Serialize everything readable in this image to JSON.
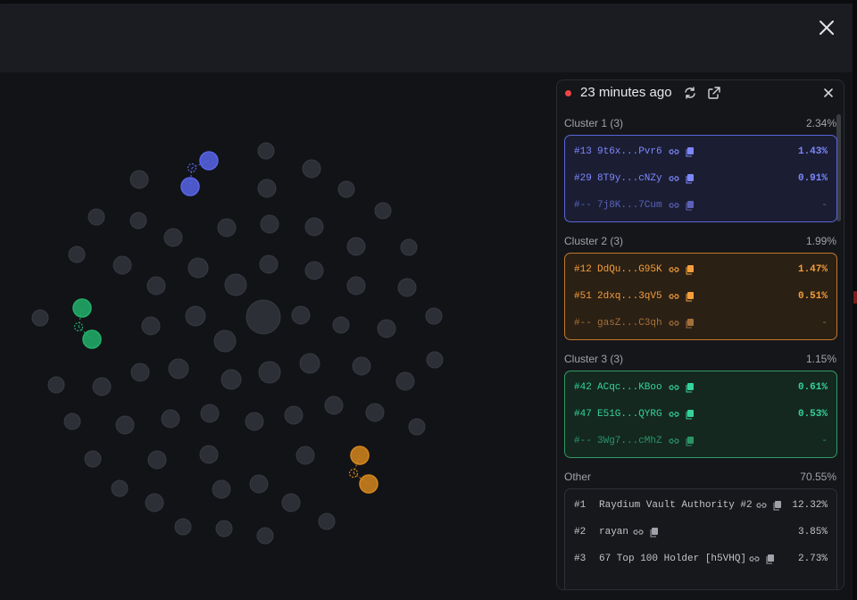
{
  "colors": {
    "blue": "#5865e8",
    "orange": "#d4861d",
    "green": "#22b06b",
    "node_gray": "#2d2f36",
    "live": "#ef4444"
  },
  "header": {
    "close_icon": "close-icon"
  },
  "panel": {
    "time": "23 minutes ago",
    "refresh_icon": "refresh-icon",
    "external_icon": "external-link-icon",
    "close_icon": "close-icon",
    "clusters": [
      {
        "title": "Cluster 1 (3)",
        "pct": "2.34%",
        "color": "blue",
        "rows": [
          {
            "rank": "#13",
            "address": "9t6x...Pvr6",
            "pct": "1.43%"
          },
          {
            "rank": "#29",
            "address": "8T9y...cNZy",
            "pct": "0.91%"
          },
          {
            "rank": "#--",
            "address": "7j8K...7Cum",
            "pct": "-"
          }
        ]
      },
      {
        "title": "Cluster 2 (3)",
        "pct": "1.99%",
        "color": "orange",
        "rows": [
          {
            "rank": "#12",
            "address": "DdQu...G95K",
            "pct": "1.47%"
          },
          {
            "rank": "#51",
            "address": "2dxq...3qV5",
            "pct": "0.51%"
          },
          {
            "rank": "#--",
            "address": "gasZ...C3qh",
            "pct": "-"
          }
        ]
      },
      {
        "title": "Cluster 3 (3)",
        "pct": "1.15%",
        "color": "green",
        "rows": [
          {
            "rank": "#42",
            "address": "ACqc...KBoo",
            "pct": "0.61%"
          },
          {
            "rank": "#47",
            "address": "E51G...QYRG",
            "pct": "0.53%"
          },
          {
            "rank": "#--",
            "address": "3Wg7...cMhZ",
            "pct": "-"
          }
        ]
      }
    ],
    "other": {
      "title": "Other",
      "pct": "70.55%",
      "rows": [
        {
          "rank": "#1",
          "name": "Raydium Vault Authority #2",
          "pct": "12.32%"
        },
        {
          "rank": "#2",
          "name": "rayan",
          "pct": "3.85%"
        },
        {
          "rank": "#3",
          "name": "67 Top 100 Holder [h5VHQ]",
          "pct": "2.73%"
        }
      ]
    }
  }
}
